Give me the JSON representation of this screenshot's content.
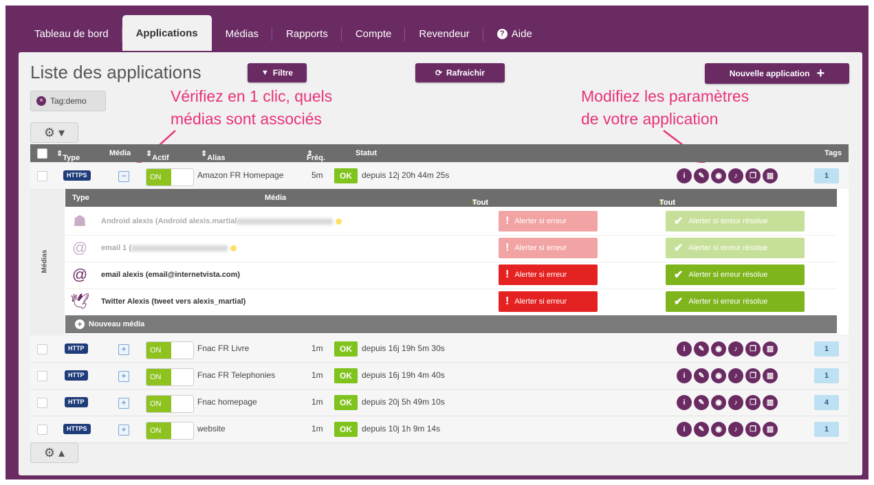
{
  "nav": {
    "tabs": [
      {
        "label": "Tableau de bord"
      },
      {
        "label": "Applications"
      },
      {
        "label": "Médias"
      },
      {
        "label": "Rapports"
      },
      {
        "label": "Compte"
      },
      {
        "label": "Revendeur"
      },
      {
        "label": "Aide"
      }
    ],
    "active_tab": "Applications"
  },
  "page": {
    "title": "Liste des applications",
    "filter_label": "Filtre",
    "refresh_label": "Rafraichir",
    "new_app_label": "Nouvelle application",
    "tag_filter": "Tag:demo"
  },
  "annotations": {
    "left_line1": "Vérifiez en 1 clic, quels",
    "left_line2": "médias sont associés",
    "right_line1": "Modifiez les paramètres",
    "right_line2": "de votre application"
  },
  "table": {
    "headers": {
      "type": "Type",
      "media": "Média",
      "actif": "Actif",
      "alias": "Alias",
      "freq": "Fréq.",
      "statut": "Statut",
      "tags": "Tags"
    },
    "rows": [
      {
        "protocol": "HTTPS",
        "expand": "−",
        "actif": "ON",
        "alias": "Amazon FR Homepage",
        "freq": "5m",
        "status": "OK",
        "since": "depuis 12j 20h 44m 25s",
        "tags": "1"
      },
      {
        "protocol": "HTTP",
        "expand": "+",
        "actif": "ON",
        "alias": "Fnac FR Livre",
        "freq": "1m",
        "status": "OK",
        "since": "depuis 16j 19h 5m 30s",
        "tags": "1"
      },
      {
        "protocol": "HTTP",
        "expand": "+",
        "actif": "ON",
        "alias": "Fnac FR Telephonies",
        "freq": "1m",
        "status": "OK",
        "since": "depuis 16j 19h 4m 40s",
        "tags": "1"
      },
      {
        "protocol": "HTTP",
        "expand": "+",
        "actif": "ON",
        "alias": "Fnac homepage",
        "freq": "1m",
        "status": "OK",
        "since": "depuis 20j 5h 49m 10s",
        "tags": "4"
      },
      {
        "protocol": "HTTPS",
        "expand": "+",
        "actif": "ON",
        "alias": "website",
        "freq": "1m",
        "status": "OK",
        "since": "depuis 10j 1h 9m 14s",
        "tags": "1"
      }
    ]
  },
  "media_panel": {
    "side_label": "Médias",
    "col_type": "Type",
    "col_media": "Média",
    "assoc_all": "Tout associer",
    "sep": " / ",
    "dissoc_all": "Tout désassocier",
    "alert_error": "Alerter si erreur",
    "alert_resolved": "Alerter si erreur résolue",
    "new_media": "Nouveau média",
    "items": [
      {
        "icon": "android-icon",
        "name": "Android alexis (Android alexis.martial",
        "faded": true
      },
      {
        "icon": "at-icon",
        "name": "email 1 (",
        "faded": true
      },
      {
        "icon": "at-icon",
        "name": "email alexis (email@internetvista.com)",
        "faded": false
      },
      {
        "icon": "twitter-bird-icon",
        "name": "Twitter Alexis (tweet vers alexis_martial)",
        "faded": false
      }
    ]
  },
  "colors": {
    "brand": "#6a2b63",
    "ok": "#7fc31c",
    "alert": "#e52222",
    "annotation": "#e8327a"
  }
}
